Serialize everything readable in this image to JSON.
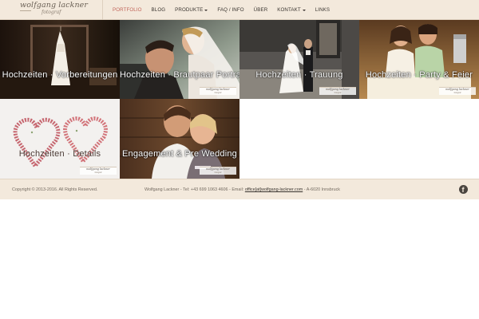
{
  "header": {
    "logo_name": "wolfgang lackner",
    "logo_sub": "fotograf",
    "nav": [
      {
        "label": "PORTFOLIO",
        "active": true,
        "dropdown": false
      },
      {
        "label": "BLOG",
        "active": false,
        "dropdown": false
      },
      {
        "label": "PRODUKTE",
        "active": false,
        "dropdown": true
      },
      {
        "label": "FAQ / INFO",
        "active": false,
        "dropdown": false
      },
      {
        "label": "ÜBER",
        "active": false,
        "dropdown": false
      },
      {
        "label": "KONTAKT",
        "active": false,
        "dropdown": true
      },
      {
        "label": "LINKS",
        "active": false,
        "dropdown": false
      }
    ]
  },
  "gallery": [
    {
      "title": "Hochzeiten · Vorbereitungen"
    },
    {
      "title": "Hochzeiten · Brautpaar Portraits"
    },
    {
      "title": "Hochzeiten · Trauung"
    },
    {
      "title": "Hochzeiten · Party & Feier"
    },
    {
      "title": "Hochzeiten · Details"
    },
    {
      "title": "Engagement & Pre Wedding"
    }
  ],
  "watermark": {
    "name": "wolfgang lackner",
    "sub": "fotograf"
  },
  "footer": {
    "copyright": "Copyright © 2013-2016. All Rights Reserved.",
    "contact_prefix": "Wolfgang Lackner - Tel: +43 699 1063 4606 - Email: ",
    "email": "office[at]wolfgang-lackner.com",
    "contact_suffix": " - A-6020 Innsbruck",
    "social_icon": "facebook-icon"
  },
  "colors": {
    "bar_bg": "#f3e9dc",
    "nav_active": "#c2665b",
    "text": "#3a3530"
  }
}
